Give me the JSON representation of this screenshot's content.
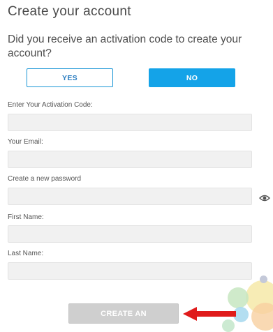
{
  "header": {
    "title": "Create your account",
    "question": "Did you receive an activation code to create your account?"
  },
  "activation_toggle": {
    "yes_label": "YES",
    "no_label": "NO",
    "selected": "NO"
  },
  "form": {
    "activation_code": {
      "label": "Enter Your Activation Code:",
      "value": "",
      "placeholder": ""
    },
    "email": {
      "label": "Your Email:",
      "value": "",
      "placeholder": ""
    },
    "password": {
      "label": "Create a new password",
      "value": "",
      "placeholder": ""
    },
    "first_name": {
      "label": "First Name:",
      "value": "",
      "placeholder": ""
    },
    "last_name": {
      "label": "Last Name:",
      "value": "",
      "placeholder": ""
    }
  },
  "submit": {
    "label": "CREATE AN"
  },
  "icons": {
    "password_toggle": "eye-icon",
    "annotation": "red-arrow-icon"
  },
  "colors": {
    "accent": "#14a3e8",
    "yes_border": "#1a96d6",
    "submit_disabled": "#cfcfcf",
    "arrow": "#e01b1b"
  }
}
